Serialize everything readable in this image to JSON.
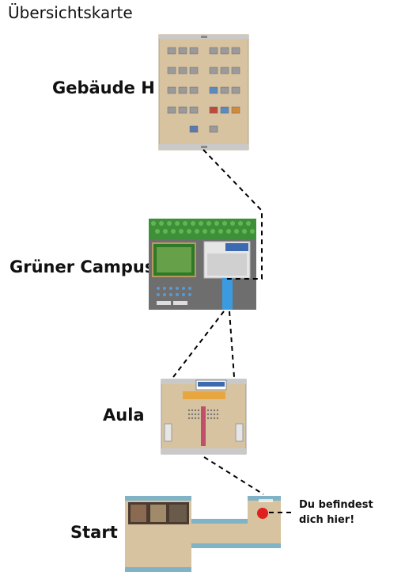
{
  "title": "Übersichtskarte",
  "maps": {
    "gebaeude_h": "Gebäude H",
    "gruener_campus": "Grüner Campus",
    "aula": "Aula",
    "start": "Start"
  },
  "you_are_here": {
    "line1": "Du befindest",
    "line2": "dich hier!"
  },
  "colors": {
    "floor": "#d8c3a0",
    "wall": "#7fb3c5",
    "grass": "#6aa84f",
    "water": "#3b9be0",
    "marker": "#e02020",
    "connector": "#000000"
  }
}
